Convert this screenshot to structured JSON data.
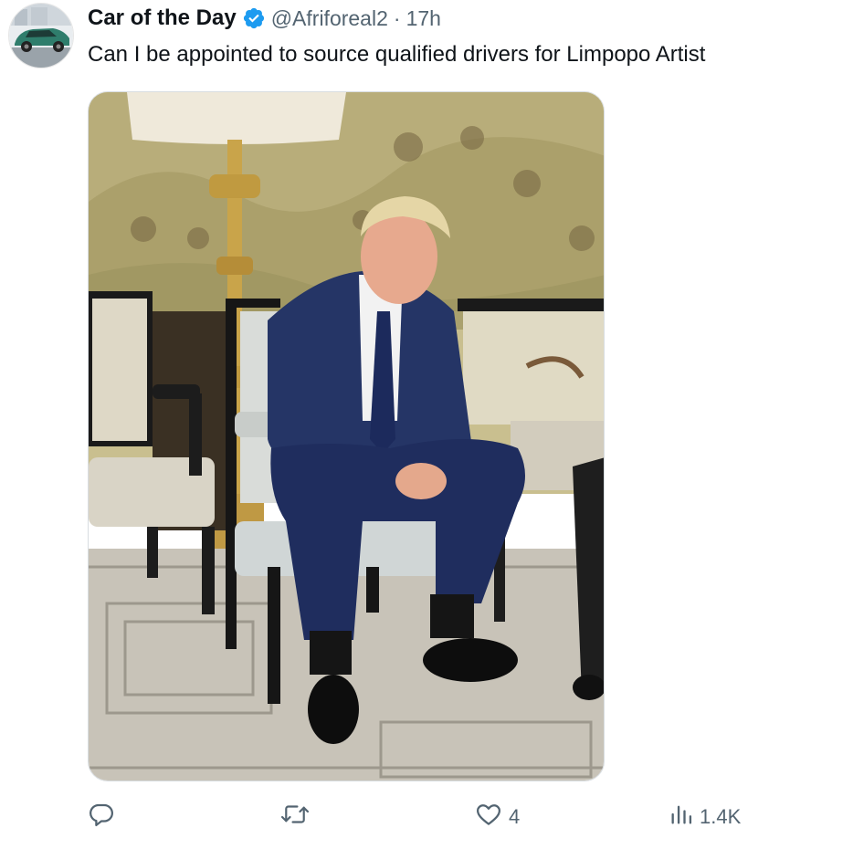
{
  "tweet": {
    "author": {
      "display_name": "Car of the Day",
      "handle": "@Afriforeal2",
      "verified": true
    },
    "separator": "·",
    "time": "17h",
    "text": "Can I be appointed to source qualified drivers for Limpopo Artist",
    "actions": {
      "reply_count": "",
      "retweet_count": "",
      "like_count": "4",
      "views_count": "1.4K"
    }
  },
  "colors": {
    "verified_badge": "#1d9bf0",
    "secondary_text": "#536471",
    "primary_text": "#0f1419"
  },
  "icons": [
    "verified-badge-icon",
    "reply-icon",
    "retweet-icon",
    "like-icon",
    "views-icon"
  ]
}
